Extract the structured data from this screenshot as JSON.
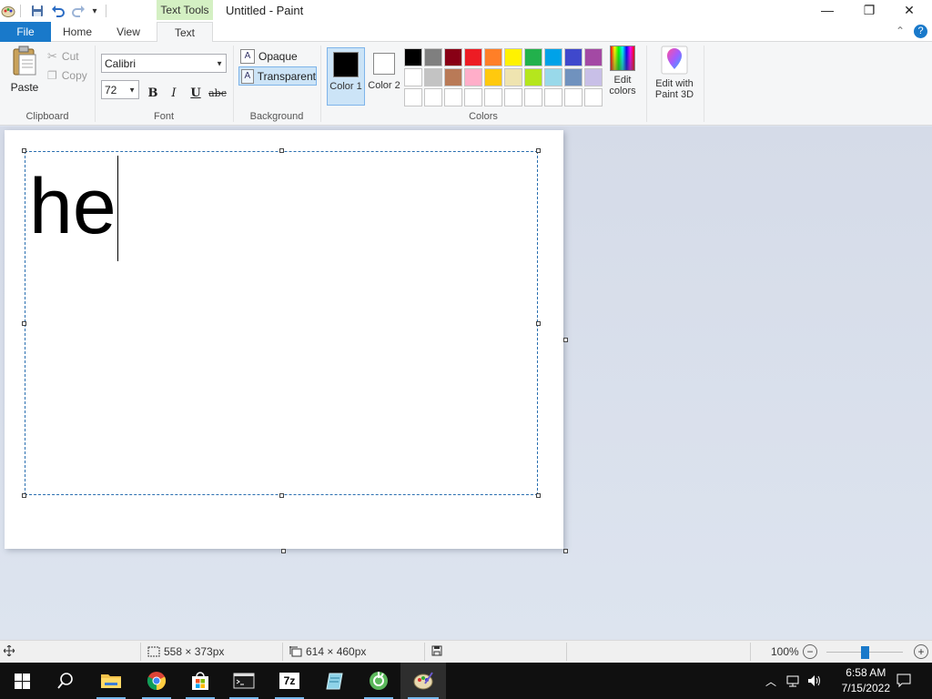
{
  "window": {
    "title": "Untitled - Paint",
    "contextual_tab": "Text Tools",
    "controls": {
      "minimize": "—",
      "maximize": "❐",
      "close": "✕"
    }
  },
  "quick_access": {
    "customize_glyph": "▾"
  },
  "tabs": {
    "file": "File",
    "home": "Home",
    "view": "View",
    "text": "Text",
    "active": "Text"
  },
  "ribbon": {
    "clipboard": {
      "paste": "Paste",
      "cut": "Cut",
      "copy": "Copy",
      "label": "Clipboard"
    },
    "font": {
      "family": "Calibri",
      "size": "72",
      "bold": "B",
      "italic": "I",
      "underline": "U",
      "strike": "abc",
      "label": "Font"
    },
    "background": {
      "opaque": "Opaque",
      "transparent": "Transparent",
      "selected": "Transparent",
      "label": "Background"
    },
    "colors": {
      "color1_label": "Color 1",
      "color2_label": "Color 2",
      "color1_value": "#000000",
      "color2_value": "#ffffff",
      "edit_colors": "Edit colors",
      "label": "Colors",
      "palette": [
        "#000000",
        "#7f7f7f",
        "#880015",
        "#ed1c24",
        "#ff7f27",
        "#fff200",
        "#22b14c",
        "#00a2e8",
        "#3f48cc",
        "#a349a4",
        "#ffffff",
        "#c3c3c3",
        "#b97a57",
        "#ffaec9",
        "#ffc90e",
        "#efe4b0",
        "#b5e61d",
        "#99d9ea",
        "#7092be",
        "#c8bfe7",
        "#ffffff",
        "#ffffff",
        "#ffffff",
        "#ffffff",
        "#ffffff",
        "#ffffff",
        "#ffffff",
        "#ffffff",
        "#ffffff",
        "#ffffff"
      ]
    },
    "paint3d": {
      "label": "Edit with Paint 3D"
    }
  },
  "canvas": {
    "typed_text": "he"
  },
  "status": {
    "selection_size": "558 × 373px",
    "canvas_size": "614 × 460px",
    "zoom": "100%",
    "zoom_minus": "−",
    "zoom_plus": "+",
    "zoom_level": 0.5
  },
  "taskbar": {
    "time": "6:58 AM",
    "date": "7/15/2022",
    "apps": [
      "start",
      "search",
      "file-explorer",
      "chrome",
      "microsoft-store",
      "terminal",
      "7-zip",
      "notepad",
      "greenshot",
      "paint"
    ]
  },
  "colors": {
    "accent": "#1979ca",
    "context_tab": "#d4f0c3",
    "selection_border": "#2a6fb0"
  }
}
